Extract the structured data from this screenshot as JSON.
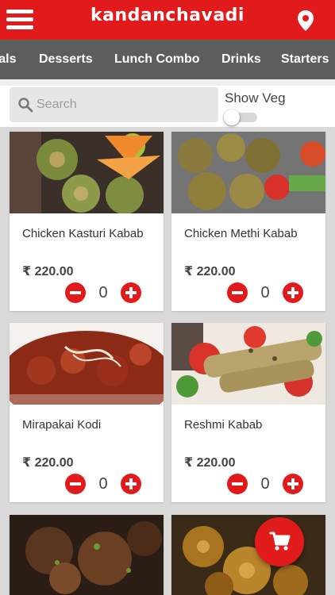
{
  "header": {
    "brand": "kandanchavadi",
    "menu_icon": "hamburger-menu-icon",
    "location_icon": "map-pin-icon"
  },
  "tabs": [
    {
      "label": "Meals"
    },
    {
      "label": "Desserts"
    },
    {
      "label": "Lunch Combo"
    },
    {
      "label": "Drinks"
    },
    {
      "label": "Starters"
    }
  ],
  "filter": {
    "search_placeholder": "Search",
    "show_veg_label": "Show Veg",
    "show_veg_on": false
  },
  "items": [
    {
      "name": "Chicken Kasturi Kabab",
      "price": "₹ 220.00",
      "qty": "0"
    },
    {
      "name": "Chicken Methi Kabab",
      "price": "₹ 220.00",
      "qty": "0"
    },
    {
      "name": "Mirapakai Kodi",
      "price": "₹ 220.00",
      "qty": "0"
    },
    {
      "name": "Reshmi Kabab",
      "price": "₹ 220.00",
      "qty": "0"
    },
    {
      "name": "",
      "price": "",
      "qty": ""
    },
    {
      "name": "",
      "price": "",
      "qty": ""
    }
  ],
  "cart": {
    "icon": "shopping-cart-icon"
  },
  "colors": {
    "accent": "#e11b1b",
    "tabbar": "#5d5d5d",
    "background": "#d9d9d9"
  }
}
